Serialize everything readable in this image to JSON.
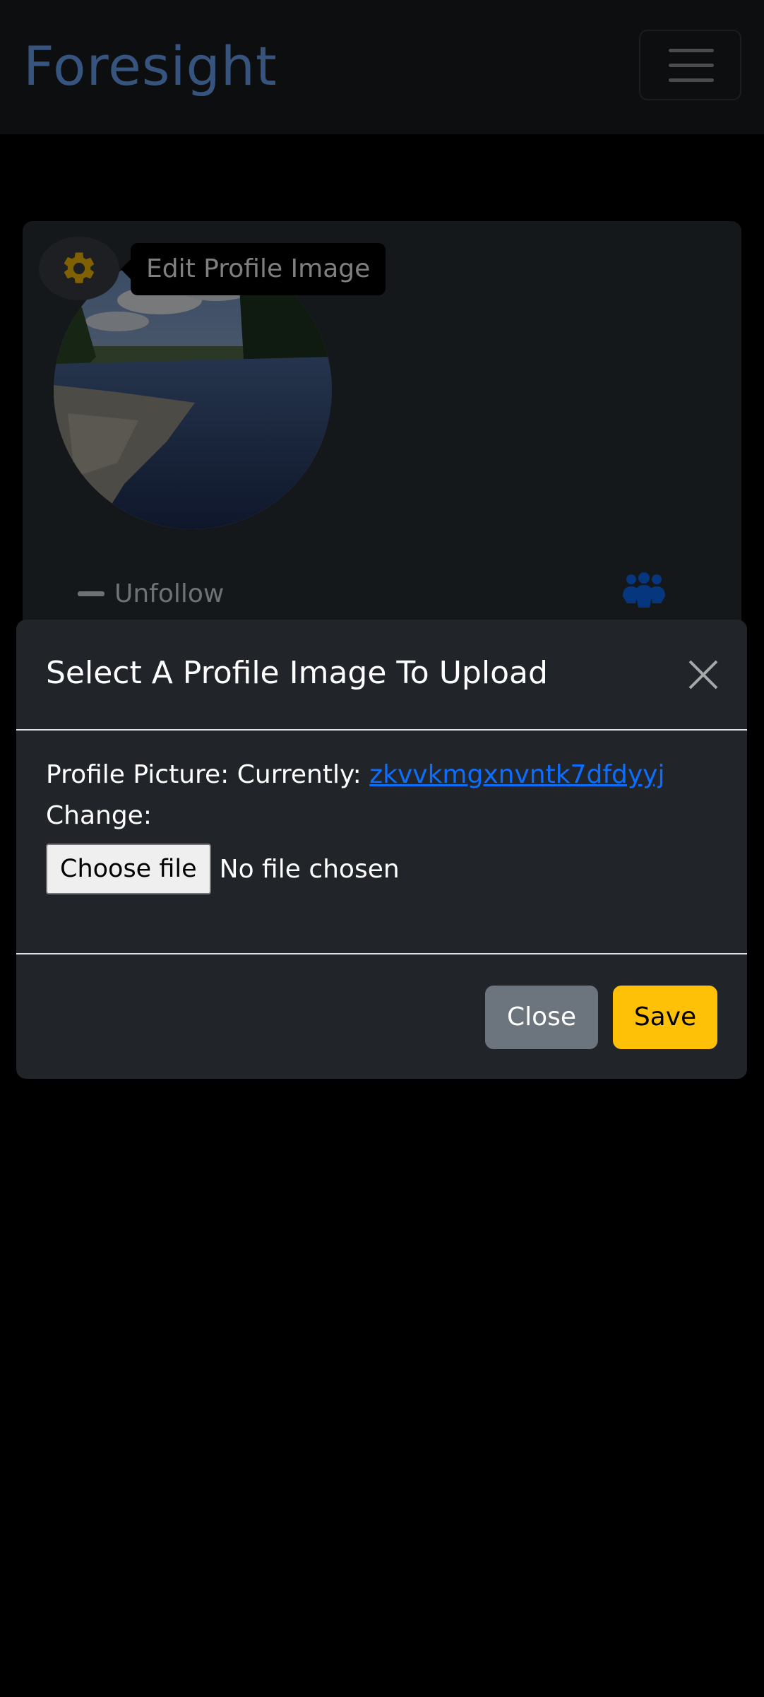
{
  "navbar": {
    "brand": "Foresight",
    "toggler_icon": "hamburger-icon"
  },
  "profile": {
    "edit_icon": "gear-icon",
    "tooltip": "Edit Profile Image",
    "unfollow_label": "Unfollow",
    "unfollow_icon": "dash-icon",
    "followers_icon": "people-icon"
  },
  "modal": {
    "title": "Select A Profile Image To Upload",
    "close_icon": "close-icon",
    "current_label": "Profile Picture: Currently: ",
    "current_file": "zkvvkmgxnvntk7dfdyyj",
    "change_label": "Change:",
    "choose_file_label": "Choose file",
    "no_file_text": "No file chosen",
    "close_button": "Close",
    "save_button": "Save"
  },
  "colors": {
    "brand": "#6ea8fe",
    "link": "#0d6efd",
    "save": "#ffc107",
    "close": "#6c757d",
    "modal_bg": "#212529",
    "gear": "#ffc107",
    "people": "#0d6efd"
  }
}
